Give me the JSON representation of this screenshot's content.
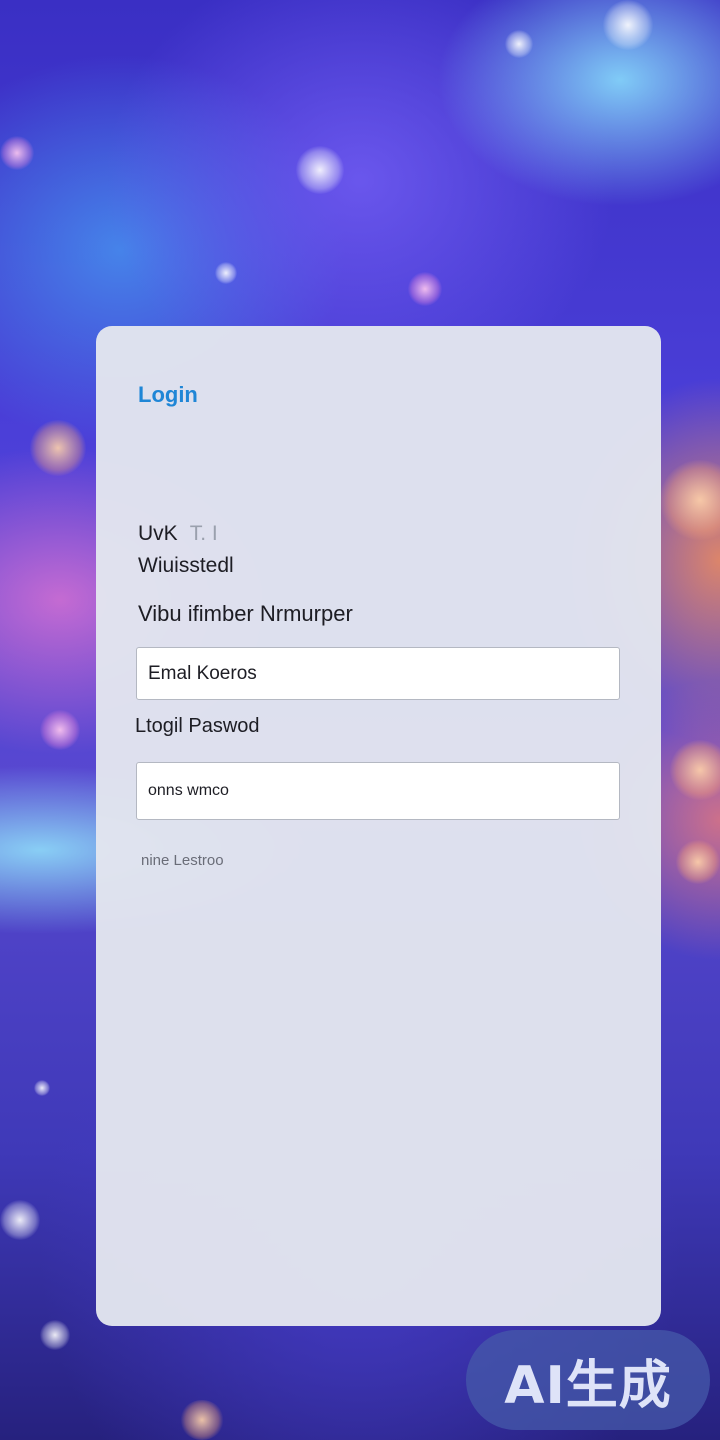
{
  "login": {
    "title": "Login",
    "line1_main": "UvK",
    "line1_faded": "T. I",
    "line2": "Wiuisstedl",
    "line3": "Vibu ifimber Nrmurper",
    "email_field": {
      "placeholder": "Emal Koeros"
    },
    "password_label": "Ltogil Paswod",
    "password_field": {
      "placeholder": "onns wmco"
    },
    "footer_link": "nine Lestroo"
  },
  "watermark": {
    "text": "AI生成"
  },
  "colors": {
    "accent": "#1f86d6",
    "card_bg": "#e2e5ee",
    "text": "#1d1d24"
  }
}
